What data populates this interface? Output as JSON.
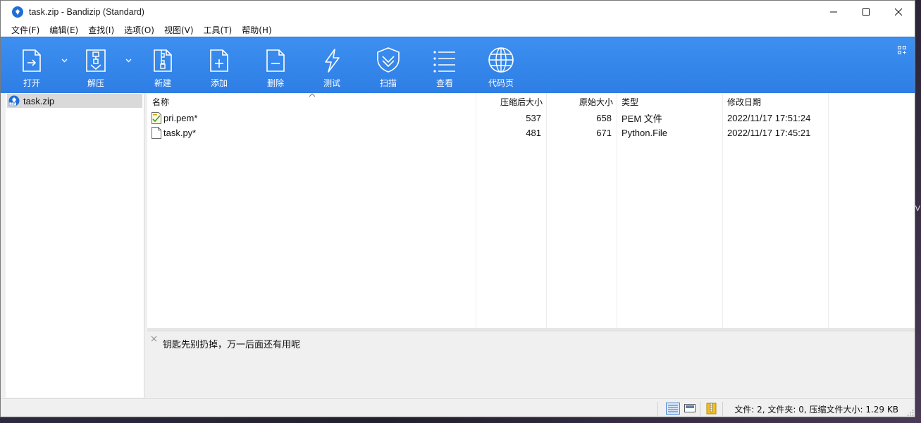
{
  "window": {
    "title": "task.zip - Bandizip (Standard)"
  },
  "menu": [
    {
      "label": "文件(F)"
    },
    {
      "label": "编辑(E)"
    },
    {
      "label": "查找(I)"
    },
    {
      "label": "选项(O)"
    },
    {
      "label": "视图(V)"
    },
    {
      "label": "工具(T)"
    },
    {
      "label": "帮助(H)"
    }
  ],
  "toolbar": {
    "open_label": "打开",
    "extract_label": "解压",
    "new_label": "新建",
    "add_label": "添加",
    "delete_label": "删除",
    "test_label": "测试",
    "scan_label": "扫描",
    "view_label": "查看",
    "codepage_label": "代码页"
  },
  "tree": {
    "root_label": "task.zip"
  },
  "columns": {
    "name": "名称",
    "compressed": "压缩后大小",
    "original": "原始大小",
    "type": "类型",
    "modified": "修改日期"
  },
  "files": [
    {
      "name": "pri.pem*",
      "compressed": "537",
      "original": "658",
      "type": "PEM 文件",
      "modified": "2022/11/17 17:51:24",
      "icon": "certificate-file-icon"
    },
    {
      "name": "task.py*",
      "compressed": "481",
      "original": "671",
      "type": "Python.File",
      "modified": "2022/11/17 17:45:21",
      "icon": "blank-file-icon"
    }
  ],
  "comment": {
    "text": "钥匙先别扔掉，万一后面还有用呢"
  },
  "status": {
    "summary": "文件: 2, 文件夹: 0, 压缩文件大小: 1.29 KB"
  },
  "desktop": {
    "edge_glyph": "V"
  },
  "colors": {
    "toolbar_blue": "#3d8ff0",
    "app_icon_blue": "#1f6fd6",
    "selection_gray": "#d9d9d9"
  }
}
